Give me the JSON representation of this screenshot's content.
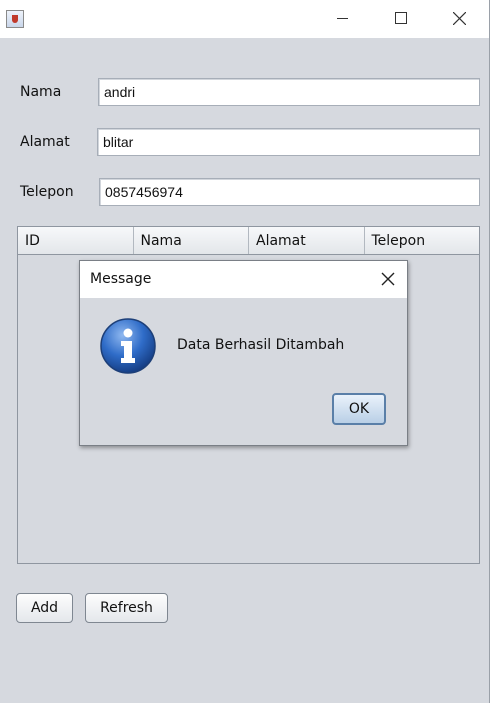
{
  "form": {
    "nama_label": "Nama",
    "nama_value": "andri",
    "alamat_label": "Alamat",
    "alamat_value": "blitar",
    "telepon_label": "Telepon",
    "telepon_value": "0857456974"
  },
  "table": {
    "columns": [
      "ID",
      "Nama",
      "Alamat",
      "Telepon"
    ],
    "rows": []
  },
  "buttons": {
    "add_label": "Add",
    "refresh_label": "Refresh"
  },
  "dialog": {
    "title": "Message",
    "message": "Data Berhasil Ditambah",
    "ok_label": "OK",
    "icon": "info-icon"
  },
  "window": {
    "icon": "java-app-icon"
  }
}
